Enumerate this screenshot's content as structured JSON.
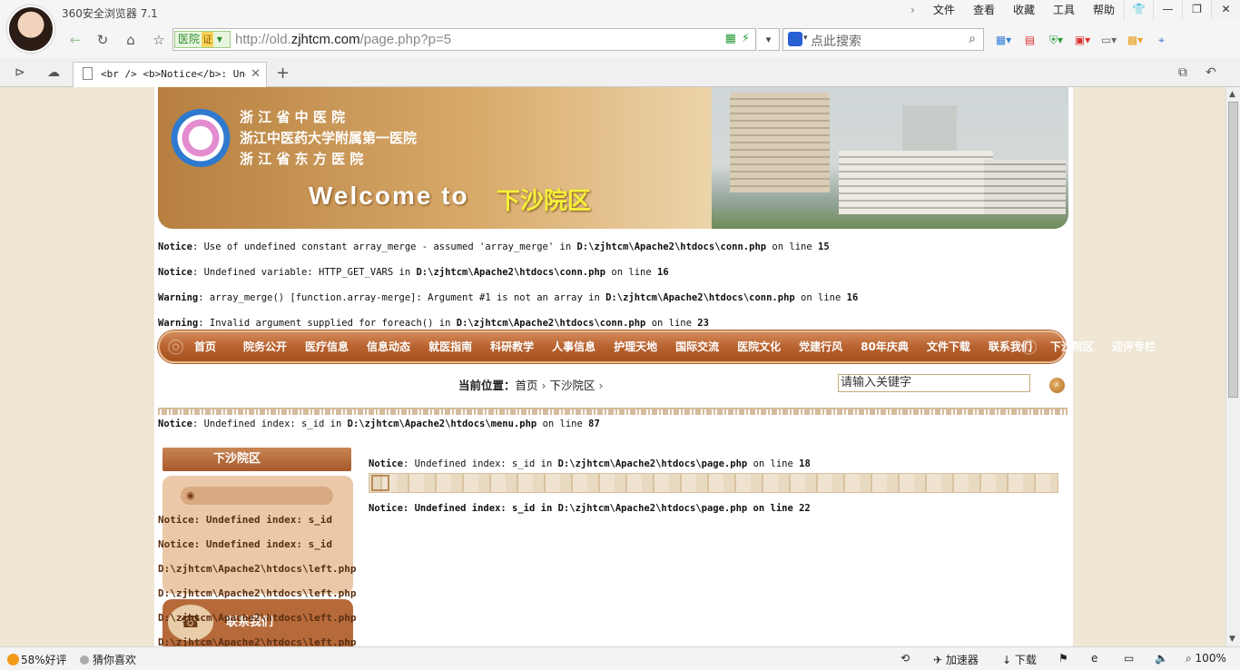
{
  "browser": {
    "app_title": "360安全浏览器 7.1",
    "menu": [
      "文件",
      "查看",
      "收藏",
      "工具",
      "帮助"
    ],
    "window_buttons": [
      "shirt-icon",
      "minimize-icon",
      "maximize-icon",
      "close-icon"
    ],
    "address": {
      "badge": "医院",
      "badge_cert": "证",
      "url_prefix": "http://old.",
      "url_domain": "zjhtcm.com",
      "url_path": "/page.php?p=5"
    },
    "search_placeholder": "点此搜索",
    "tab": {
      "title": "<br /> <b>Notice</b>: Undefi"
    }
  },
  "page": {
    "banner": {
      "name1": "浙 江 省 中 医 院",
      "name2": "浙江中医药大学附属第一医院",
      "name3": "浙 江 省 东 方 医 院",
      "welcome": "Welcome to",
      "campus": "下沙院区"
    },
    "notices": [
      {
        "type": "Notice",
        "text": ": Use of undefined constant array_merge - assumed 'array_merge' in ",
        "file": "D:\\zjhtcm\\Apache2\\htdocs\\conn.php",
        "tail": " on line ",
        "line": "15"
      },
      {
        "type": "Notice",
        "text": ": Undefined variable: HTTP_GET_VARS in ",
        "file": "D:\\zjhtcm\\Apache2\\htdocs\\conn.php",
        "tail": " on line ",
        "line": "16"
      },
      {
        "type": "Warning",
        "text": ": array_merge() [function.array-merge]: Argument #1 is not an array in ",
        "file": "D:\\zjhtcm\\Apache2\\htdocs\\conn.php",
        "tail": " on line ",
        "line": "16"
      },
      {
        "type": "Warning",
        "text": ": Invalid argument supplied for foreach() in ",
        "file": "D:\\zjhtcm\\Apache2\\htdocs\\conn.php",
        "tail": " on line ",
        "line": "23"
      }
    ],
    "nav_menu": [
      "首页",
      "院务公开",
      "医疗信息",
      "信息动态",
      "就医指南",
      "科研教学",
      "人事信息",
      "护理天地",
      "国际交流",
      "医院文化",
      "党建行风",
      "80年庆典",
      "文件下载",
      "联系我们",
      "下沙院区",
      "迎评专栏"
    ],
    "breadcrumb": {
      "label": "当前位置：",
      "home": "首页",
      "current": "下沙院区"
    },
    "keyword_placeholder": "请输入关键字",
    "menu_notice": {
      "type": "Notice",
      "text": ": Undefined index: s_id in ",
      "file": "D:\\zjhtcm\\Apache2\\htdocs\\menu.php",
      "tail": " on line ",
      "line": "87"
    },
    "sidebar": {
      "title": "下沙院区",
      "lines": [
        "Notice: Undefined index: s_id",
        "Notice: Undefined index: s_id",
        "D:\\zjhtcm\\Apache2\\htdocs\\left.php",
        "D:\\zjhtcm\\Apache2\\htdocs\\left.php",
        "D:\\zjhtcm\\Apache2\\htdocs\\left.php",
        "D:\\zjhtcm\\Apache2\\htdocs\\left.php"
      ],
      "contact_title": "联系我们"
    },
    "content": {
      "notice1": {
        "type": "Notice",
        "text": ": Undefined index: s_id in ",
        "file": "D:\\zjhtcm\\Apache2\\htdocs\\page.php",
        "tail": " on line ",
        "line": "18"
      },
      "notice2": "Notice: Undefined index: s_id in D:\\zjhtcm\\Apache2\\htdocs\\page.php on line 22"
    }
  },
  "statusbar": {
    "rating": "58%好评",
    "guess": "猜你喜欢",
    "accelerator": "加速器",
    "download": "下载",
    "zoom": "100%"
  }
}
